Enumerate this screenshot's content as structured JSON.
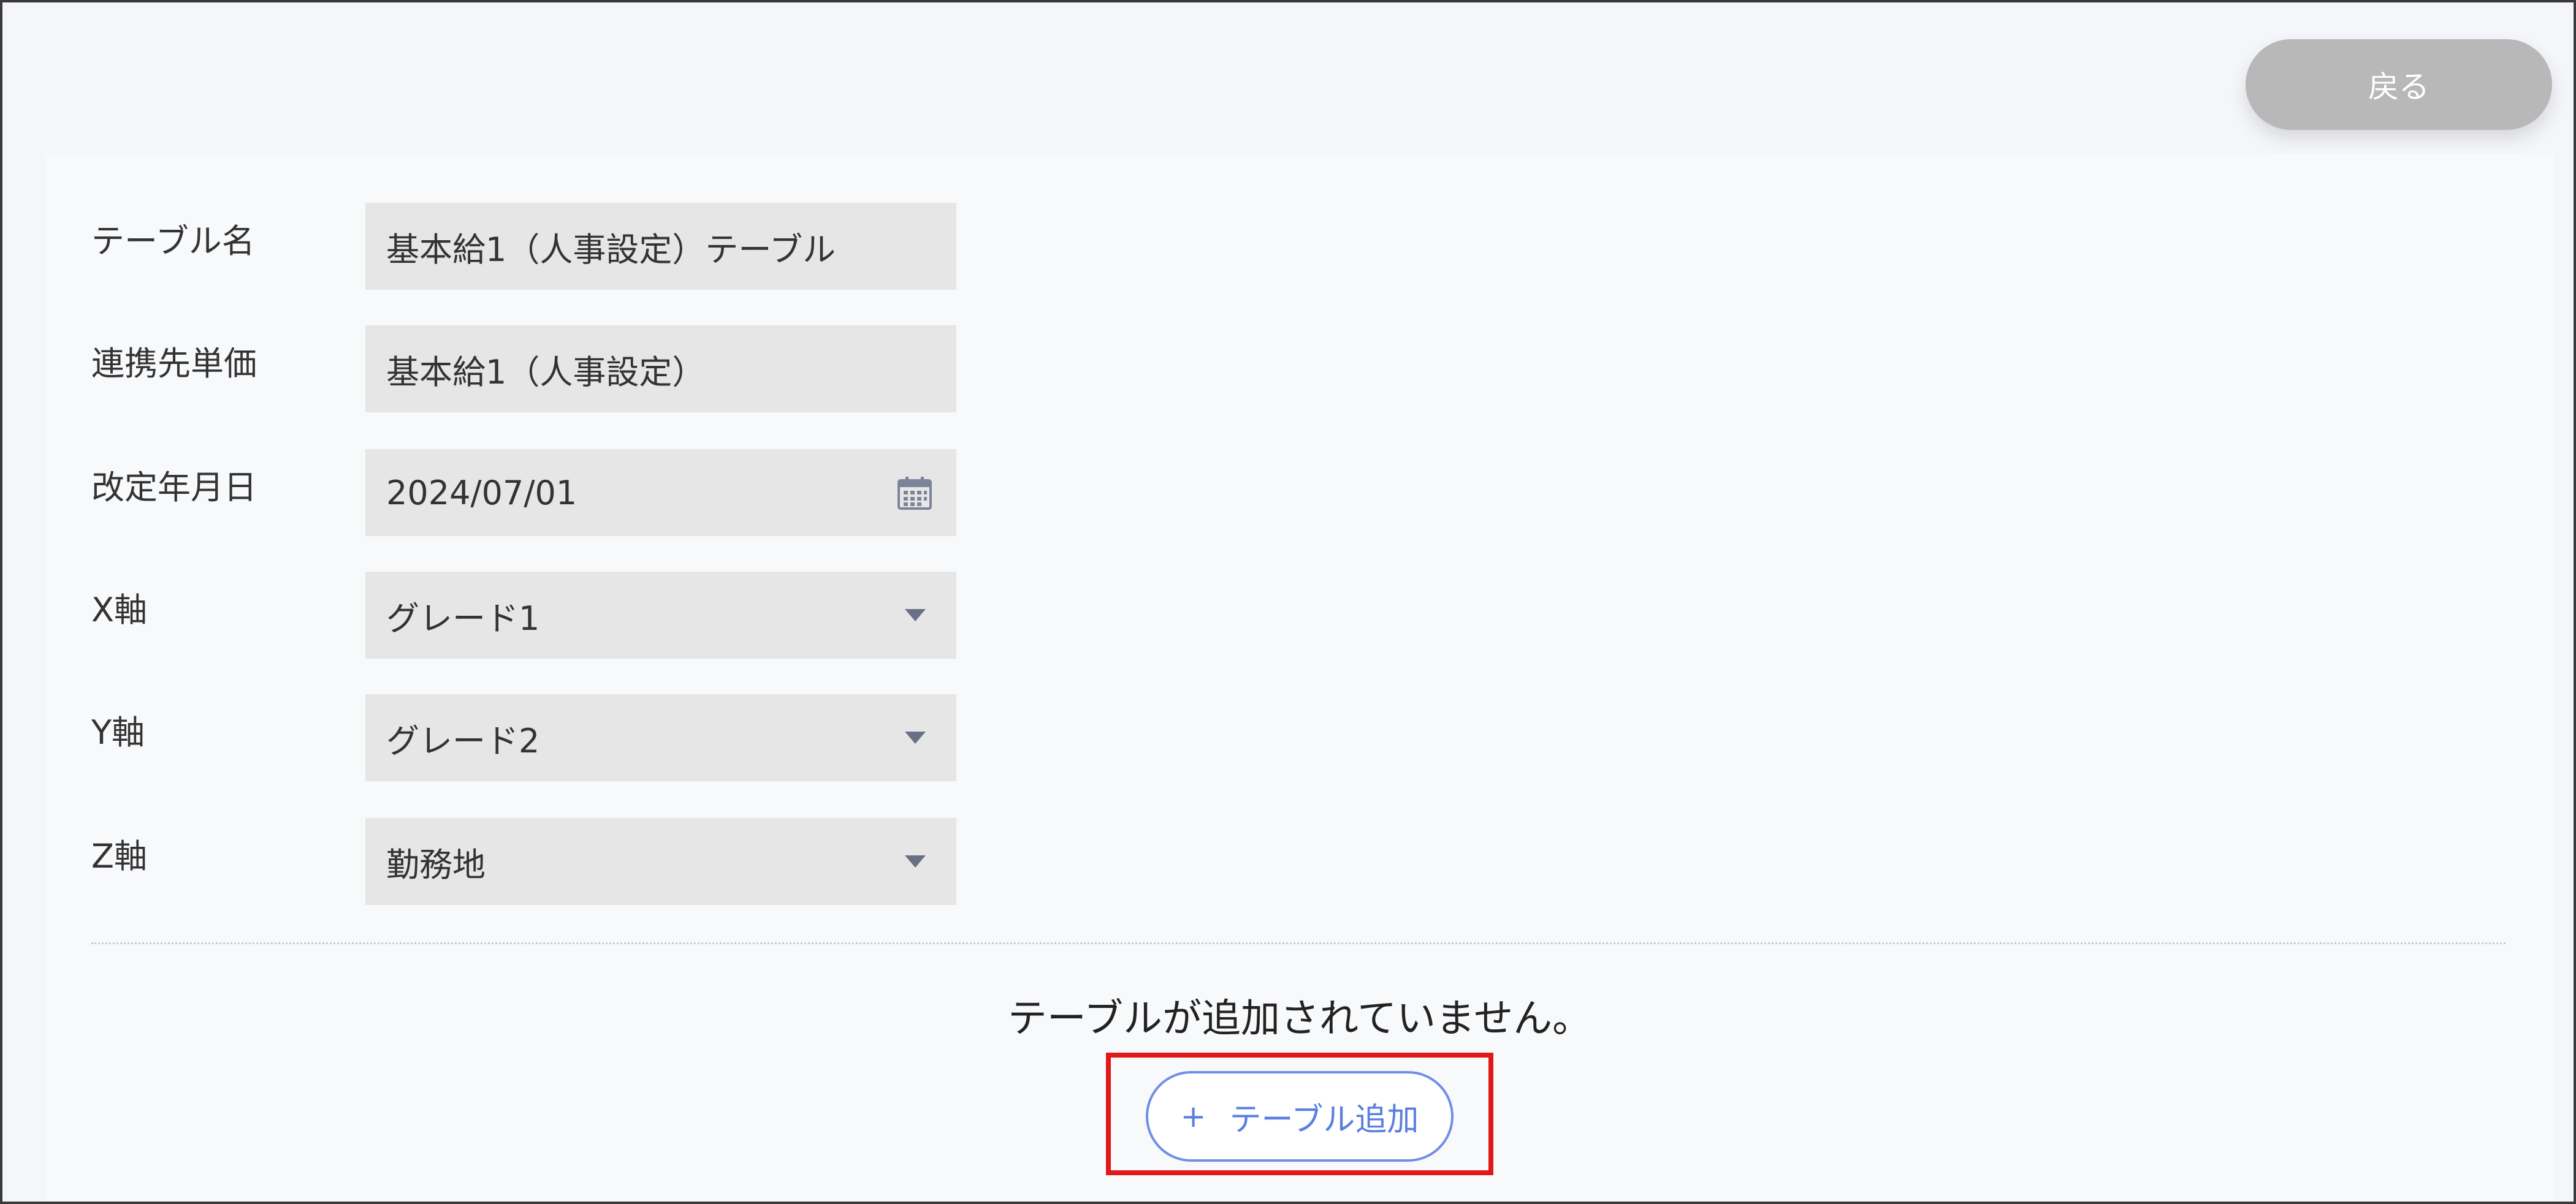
{
  "header": {
    "back_label": "戻る"
  },
  "form": {
    "table_name": {
      "label": "テーブル名",
      "value": "基本給1（人事設定）テーブル"
    },
    "linked_unit_price": {
      "label": "連携先単価",
      "value": "基本給1（人事設定）"
    },
    "revision_date": {
      "label": "改定年月日",
      "value": "2024/07/01",
      "icon": "calendar-icon"
    },
    "x_axis": {
      "label": "X軸",
      "value": "グレード1",
      "icon": "chevron-down-icon"
    },
    "y_axis": {
      "label": "Y軸",
      "value": "グレード2",
      "icon": "chevron-down-icon"
    },
    "z_axis": {
      "label": "Z軸",
      "value": "勤務地",
      "icon": "chevron-down-icon"
    }
  },
  "table_section": {
    "empty_message": "テーブルが追加されていません。",
    "add_button": {
      "icon_text": "+",
      "label": "テーブル追加"
    }
  },
  "colors": {
    "page_background": "#f5f6f9",
    "field_background": "#e6e6e6",
    "back_button": "#b8b8b8",
    "accent_blue": "#5a7fe0",
    "highlight_red": "#e01818"
  }
}
